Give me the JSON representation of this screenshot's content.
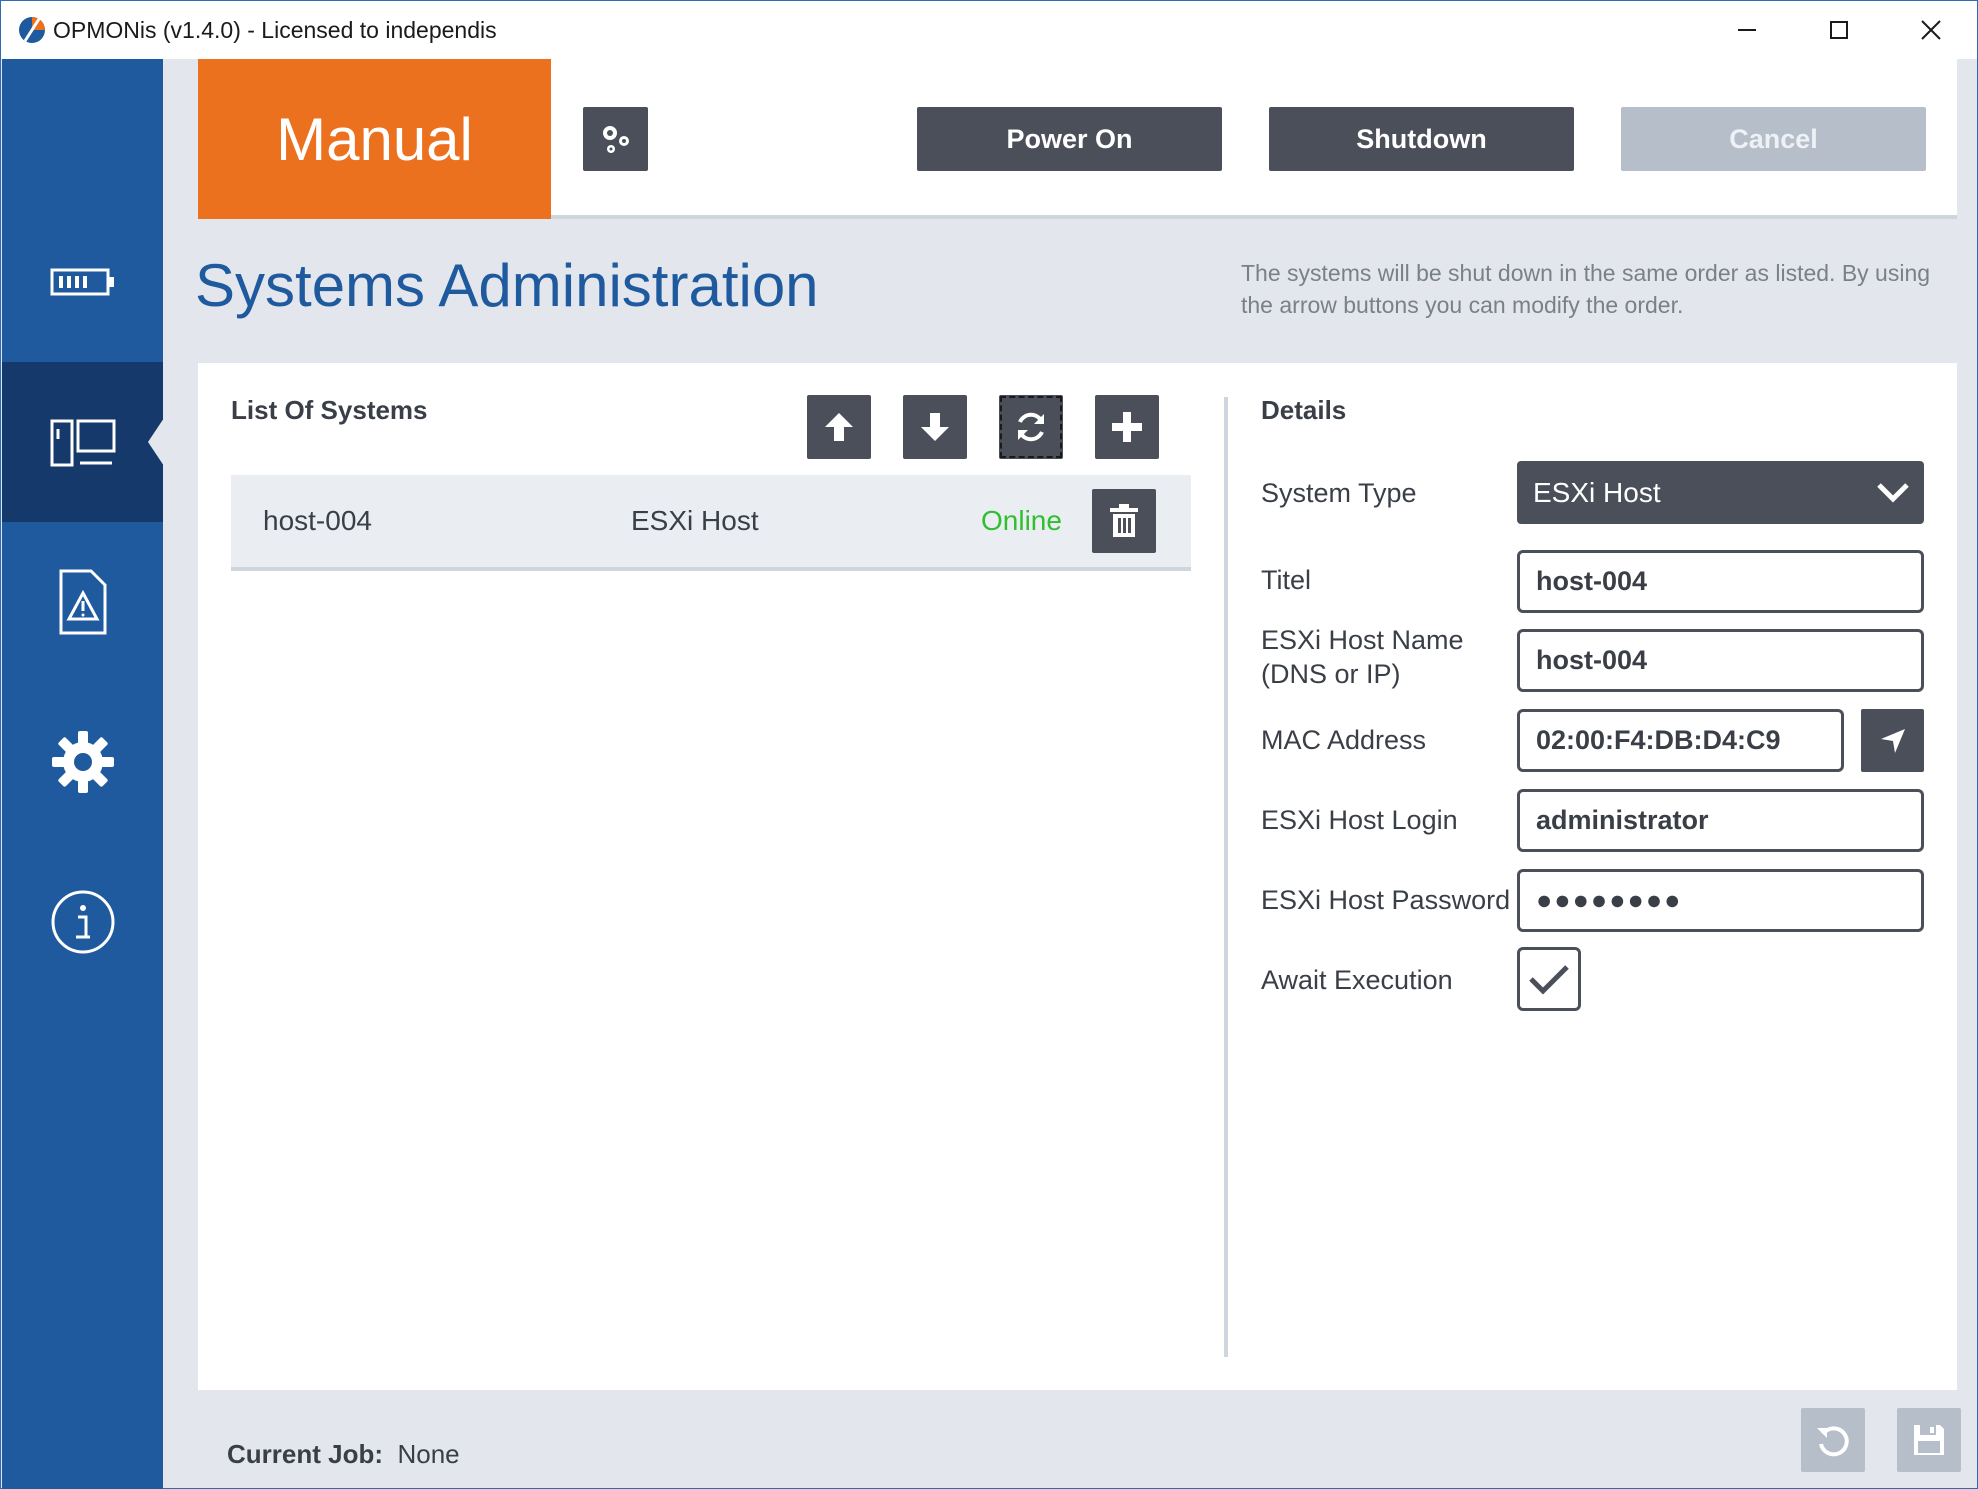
{
  "window": {
    "title": "OPMONis (v1.4.0) - Licensed to independis"
  },
  "sidebar": {
    "items": [
      {
        "icon": "battery-icon",
        "active": false
      },
      {
        "icon": "systems-icon",
        "active": true
      },
      {
        "icon": "warning-document-icon",
        "active": false
      },
      {
        "icon": "gear-icon",
        "active": false
      },
      {
        "icon": "info-icon",
        "active": false
      }
    ]
  },
  "toolbar": {
    "mode_label": "Manual",
    "power_on_label": "Power On",
    "shutdown_label": "Shutdown",
    "cancel_label": "Cancel"
  },
  "header": {
    "title": "Systems Administration",
    "hint": "The systems will be shut down in the same order as listed. By using the arrow buttons you can modify the order."
  },
  "systems_list": {
    "title": "List Of Systems",
    "rows": [
      {
        "name": "host-004",
        "type": "ESXi Host",
        "status": "Online"
      }
    ]
  },
  "details": {
    "title": "Details",
    "system_type_label": "System Type",
    "system_type_value": "ESXi Host",
    "titel_label": "Titel",
    "titel_value": "host-004",
    "hostname_label_line1": "ESXi Host Name",
    "hostname_label_line2": "(DNS or IP)",
    "hostname_value": "host-004",
    "mac_label": "MAC Address",
    "mac_value": "02:00:F4:DB:D4:C9",
    "login_label": "ESXi Host Login",
    "login_value": "administrator",
    "password_label": "ESXi Host Password",
    "password_value": "●●●●●●●●",
    "await_label": "Await Execution",
    "await_checked": true
  },
  "footer": {
    "current_job_label": "Current Job:",
    "current_job_value": "None"
  },
  "colors": {
    "sidebar": "#1f5a9e",
    "sidebar_active": "#15396a",
    "mode_tile": "#ec711e",
    "button_dark": "#4a4f59",
    "button_disabled": "#b6bec9",
    "status_online": "#2fbf2f",
    "title_blue": "#1f5a9e"
  }
}
